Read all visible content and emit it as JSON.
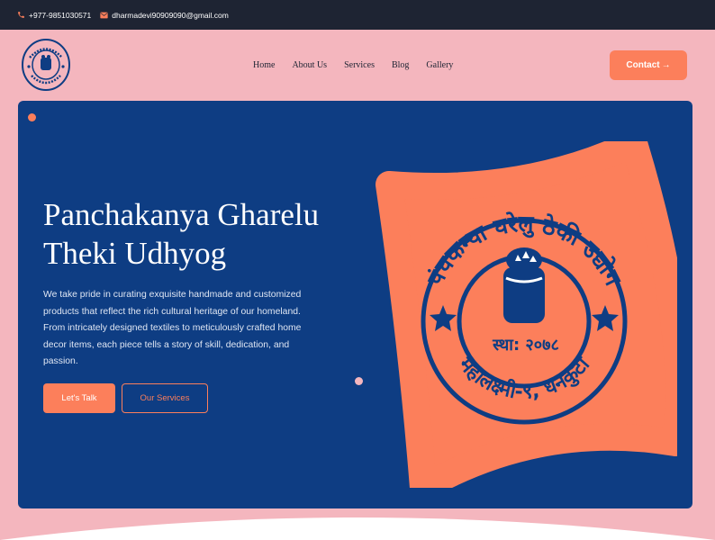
{
  "topbar": {
    "phone": "+977-9851030571",
    "email": "dharmadevi90909090@gmail.com"
  },
  "nav": {
    "items": [
      {
        "label": "Home"
      },
      {
        "label": "About Us"
      },
      {
        "label": "Services"
      },
      {
        "label": "Blog"
      },
      {
        "label": "Gallery"
      }
    ],
    "contact_label": "Contact",
    "contact_arrow": "→"
  },
  "hero": {
    "title_line1": "Panchakanya Gharelu",
    "title_line2": "Theki Udhyog",
    "description": "We take pride in curating exquisite handmade and customized products that reflect the rich cultural heritage of our homeland. From intricately designed textiles to meticulously crafted home decor items, each piece tells a story of skill, dedication, and passion.",
    "primary_button": "Let's Talk",
    "secondary_button": "Our Services"
  },
  "emblem": {
    "top_text": "पंचकन्या घरेलु ठेकी उद्योग",
    "bottom_text": "महालक्ष्मी-९, धनकुटा",
    "est_text": "स्था: २०७८"
  },
  "colors": {
    "topbar": "#1e2433",
    "page": "#f4b6be",
    "hero": "#0e3d83",
    "accent": "#fc7f5b"
  }
}
